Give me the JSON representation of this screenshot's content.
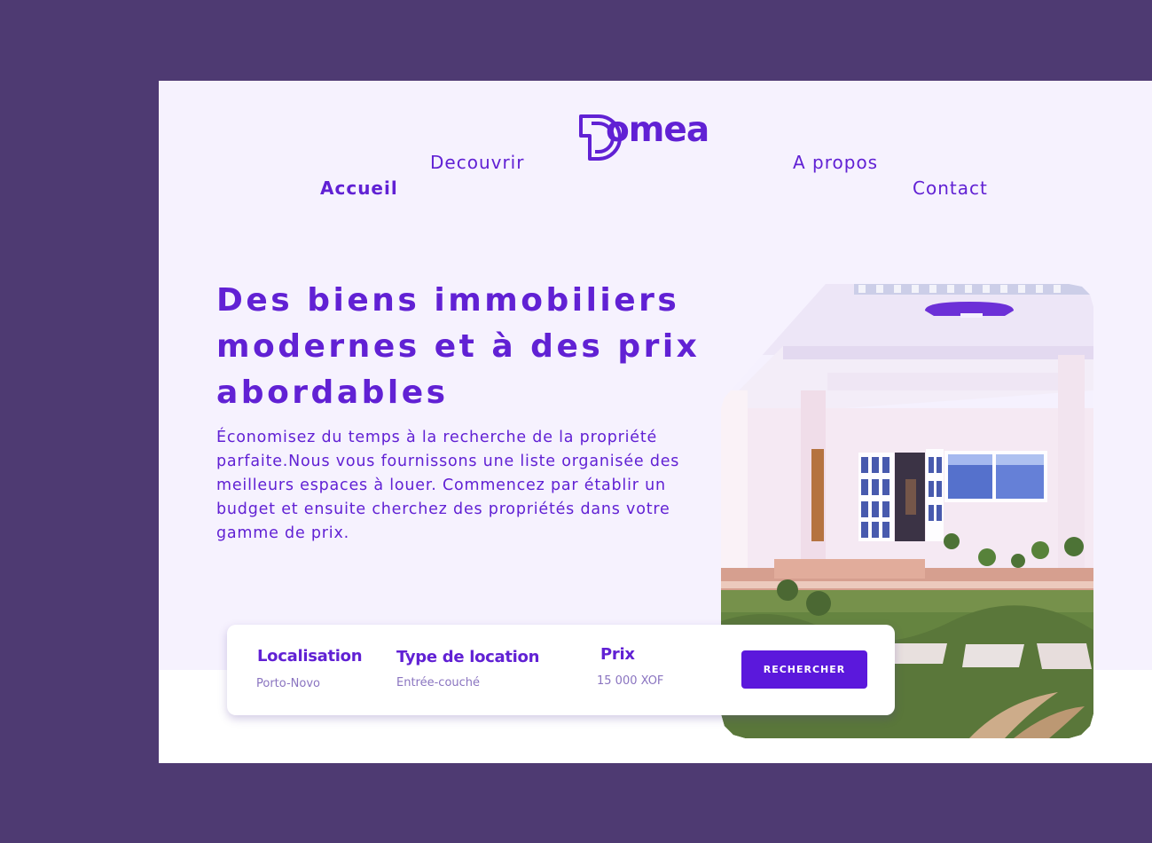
{
  "brand": {
    "name": "omea",
    "logo_letter": "D"
  },
  "nav": {
    "accueil": "Accueil",
    "decouvrir": "Decouvrir",
    "apropos": "A propos",
    "contact": "Contact"
  },
  "hero": {
    "title": "Des biens immobiliers modernes et à des prix abordables",
    "description": "Économisez du temps à la recherche de la propriété parfaite.Nous vous fournissons une liste organisée des meilleurs espaces à louer. Commencez par établir un budget et ensuite cherchez des propriétés dans votre gamme de prix."
  },
  "search": {
    "location_label": "Localisation",
    "location_value": "Porto-Novo",
    "type_label": "Type de location",
    "type_value": "Entrée-couché",
    "price_label": "Prix",
    "price_value": "15 000  XOF",
    "button": "RECHERCHER"
  },
  "colors": {
    "frame": "#4e3a72",
    "page": "#f6f2fe",
    "accent": "#6121d4",
    "button": "#5b18dc"
  }
}
